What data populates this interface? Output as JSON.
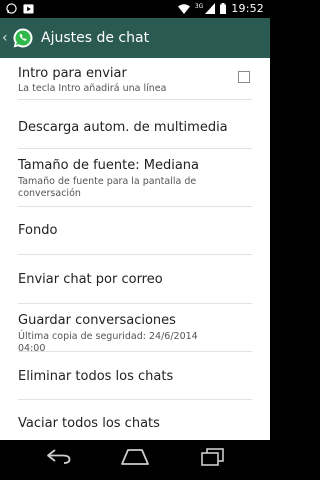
{
  "status_bar": {
    "icons": [
      "whatsapp-notification-icon",
      "play-store-notification-icon",
      "wifi-icon",
      "signal-icon",
      "battery-icon"
    ],
    "network": "3G",
    "time": "19:52"
  },
  "action_bar": {
    "title": "Ajustes de chat",
    "logo": "whatsapp-logo",
    "colors": {
      "background": "#2a5a52"
    }
  },
  "settings": {
    "items": [
      {
        "title": "Intro para enviar",
        "subtitle": "La tecla Intro añadirá una línea",
        "checkbox": false
      },
      {
        "title": "Descarga autom. de multimedia"
      },
      {
        "title": "Tamaño de fuente: Mediana",
        "subtitle": "Tamaño de fuente para la pantalla de conversación"
      },
      {
        "title": "Fondo"
      },
      {
        "title": "Enviar chat por correo"
      },
      {
        "title": "Guardar conversaciones",
        "subtitle": "Última copia de seguridad: 24/6/2014 04:00"
      },
      {
        "title": "Eliminar todos los chats"
      },
      {
        "title": "Vaciar todos los chats"
      }
    ]
  },
  "nav_bar": {
    "buttons": [
      "back-icon",
      "home-icon",
      "recent-apps-icon"
    ]
  }
}
